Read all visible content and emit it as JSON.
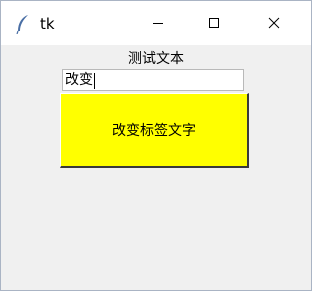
{
  "window": {
    "title": "tk",
    "icon": "feather-icon",
    "controls": [
      "minimize-icon",
      "maximize-icon",
      "close-icon"
    ]
  },
  "label": {
    "text": "测试文本"
  },
  "entry": {
    "value": "改变"
  },
  "button": {
    "label": "改变标签文字",
    "background": "#ffff00"
  }
}
